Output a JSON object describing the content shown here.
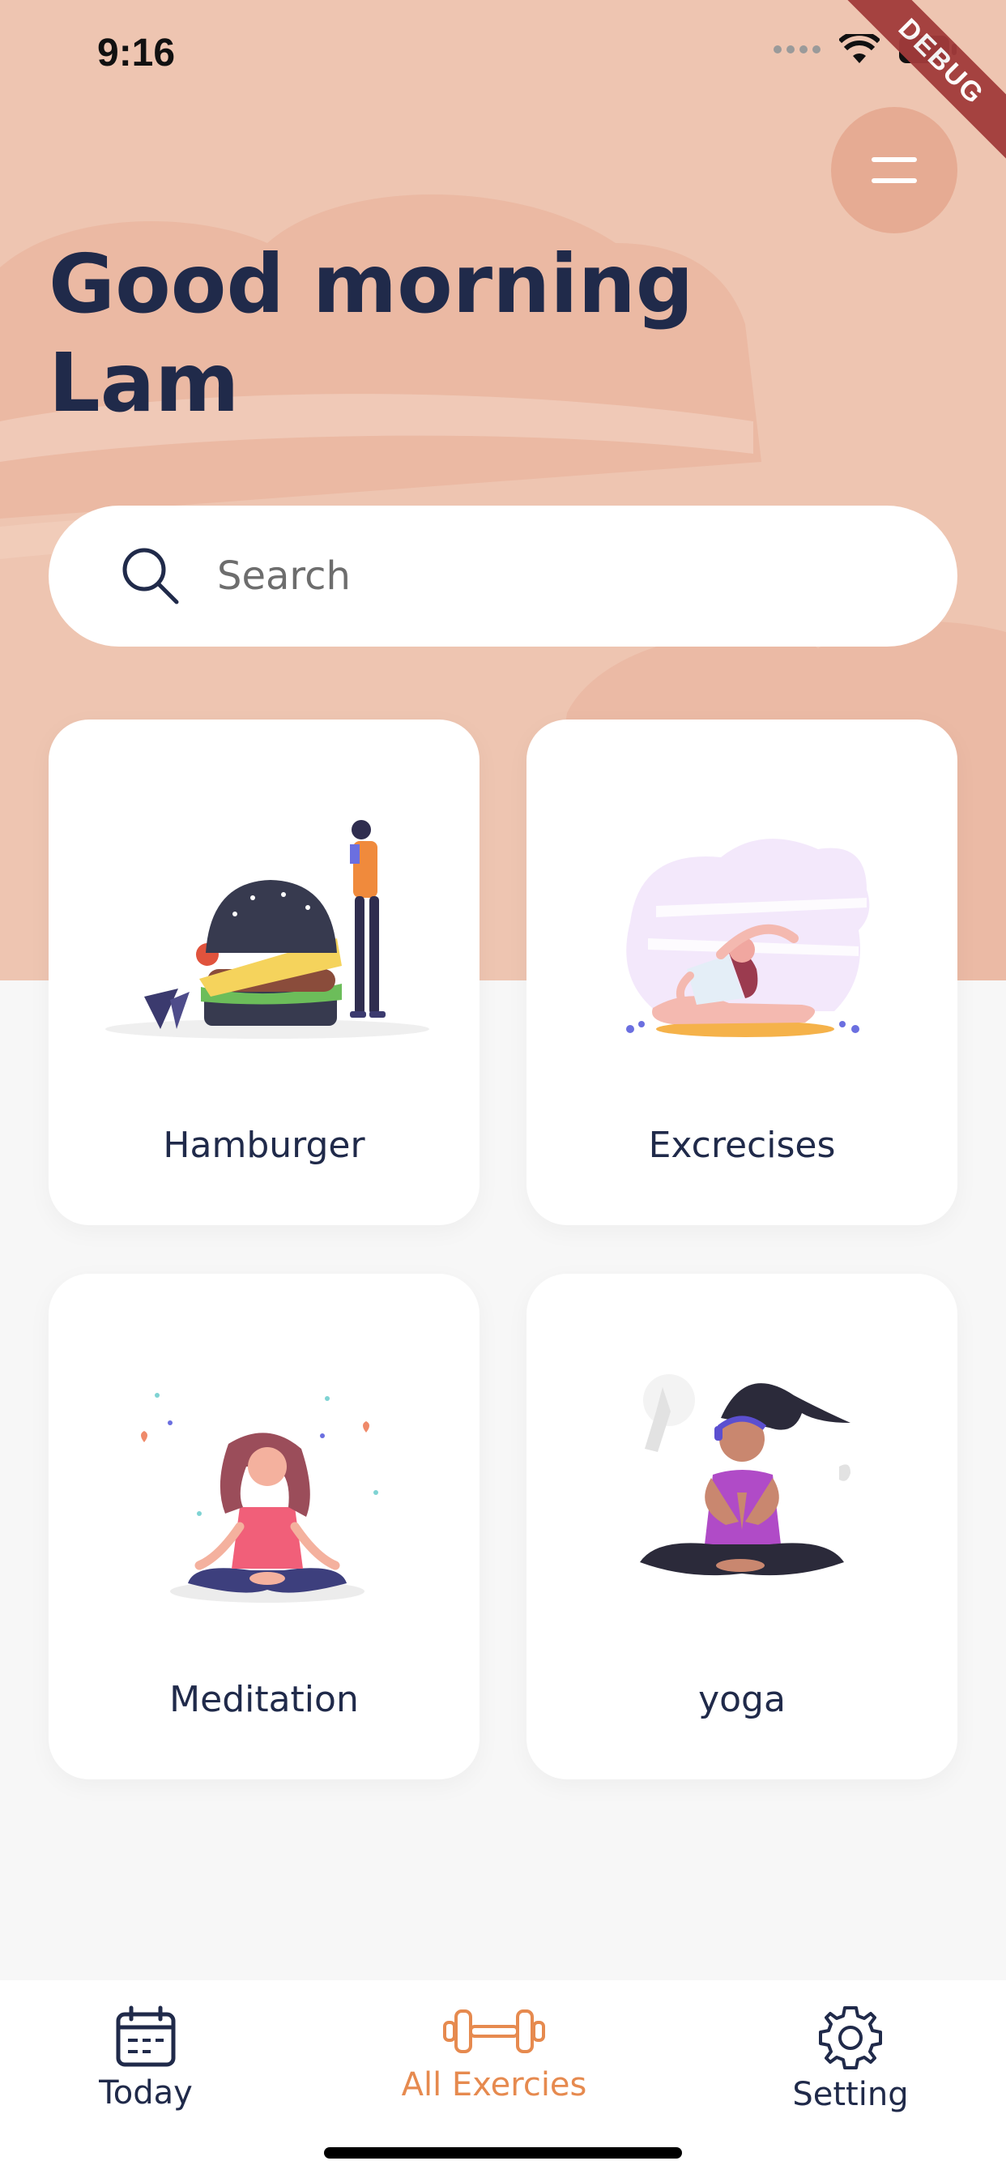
{
  "status_bar": {
    "time": "9:16",
    "debug_banner": "DEBUG"
  },
  "header": {
    "greeting": "Good morning\nLam",
    "menu_icon": "menu-icon"
  },
  "search": {
    "placeholder": "Search",
    "value": "",
    "icon": "search-icon"
  },
  "categories": [
    {
      "label": "Hamburger"
    },
    {
      "label": "Excrecises"
    },
    {
      "label": "Meditation"
    },
    {
      "label": "yoga"
    }
  ],
  "bottom_nav": {
    "items": [
      {
        "label": "Today",
        "icon": "calendar-icon",
        "active": false
      },
      {
        "label": "All Exercies",
        "icon": "dumbbell-icon",
        "active": true
      },
      {
        "label": "Setting",
        "icon": "gear-icon",
        "active": false
      }
    ],
    "active_color": "#e68a4f",
    "inactive_color": "#202a4a"
  },
  "colors": {
    "hero_bg": "#eec5b1",
    "title": "#202a4a",
    "page_bg": "#f7f7f7"
  }
}
